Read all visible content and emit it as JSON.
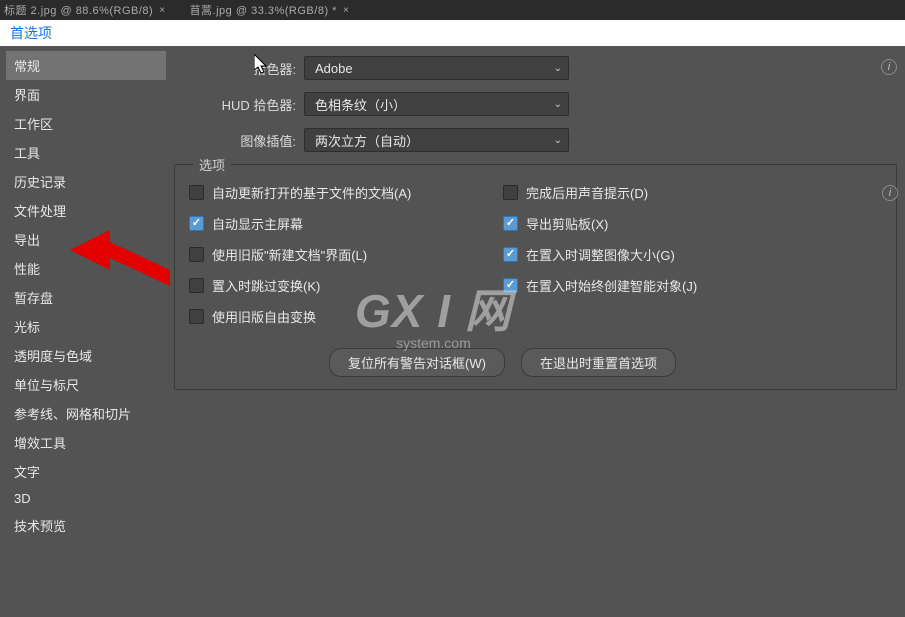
{
  "top_tabs": {
    "tab1": "标题 2.jpg @ 88.6%(RGB/8)",
    "tab2": "苜蒿.jpg @ 33.3%(RGB/8) *"
  },
  "dialog_title": "首选项",
  "sidebar": {
    "items": [
      "常规",
      "界面",
      "工作区",
      "工具",
      "历史记录",
      "文件处理",
      "导出",
      "性能",
      "暂存盘",
      "光标",
      "透明度与色域",
      "单位与标尺",
      "参考线、网格和切片",
      "增效工具",
      "文字",
      "3D",
      "技术预览"
    ]
  },
  "form": {
    "picker_label": "拾色器:",
    "picker_value": "Adobe",
    "hud_label": "HUD 拾色器:",
    "hud_value": "色相条纹（小）",
    "interp_label": "图像插值:",
    "interp_value": "两次立方（自动）"
  },
  "options": {
    "legend": "选项",
    "auto_update": "自动更新打开的基于文件的文档(A)",
    "beep_done": "完成后用声音提示(D)",
    "show_home": "自动显示主屏幕",
    "export_clip": "导出剪贴板(X)",
    "legacy_new": "使用旧版\"新建文档\"界面(L)",
    "resize_place": "在置入时调整图像大小(G)",
    "skip_transform": "置入时跳过变换(K)",
    "smart_obj": "在置入时始终创建智能对象(J)",
    "legacy_free": "使用旧版自由变换"
  },
  "buttons": {
    "reset_warnings": "复位所有警告对话框(W)",
    "reset_on_quit": "在退出时重置首选项"
  },
  "watermark": {
    "big": "GX I 网",
    "small": "system.com"
  }
}
